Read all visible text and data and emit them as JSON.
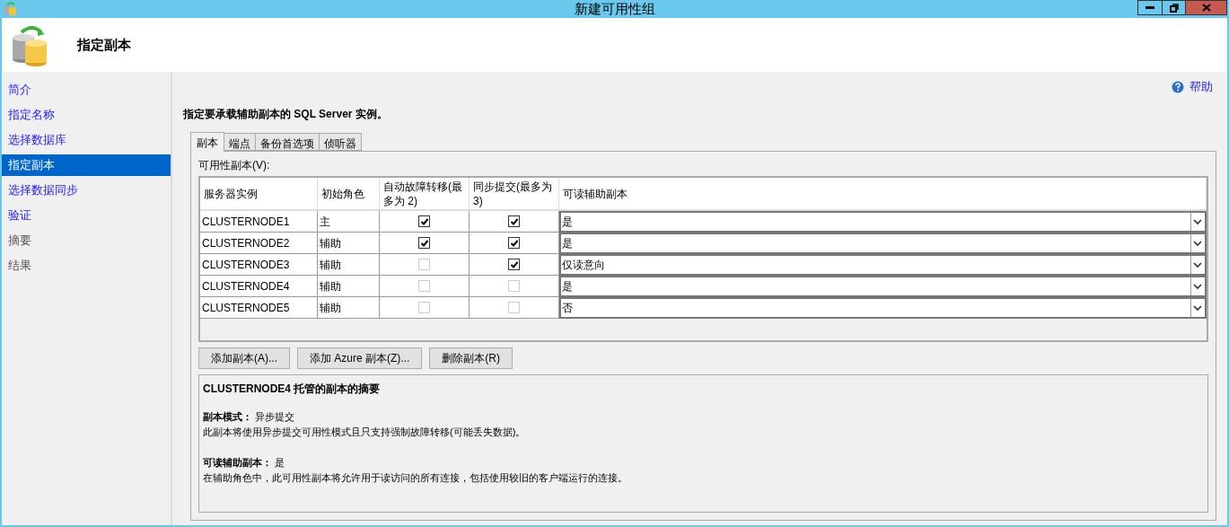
{
  "window": {
    "title": "新建可用性组"
  },
  "header": {
    "title": "指定副本"
  },
  "help": {
    "label": "帮助"
  },
  "sidebar": {
    "items": [
      {
        "label": "简介",
        "selected": false,
        "disabled": false
      },
      {
        "label": "指定名称",
        "selected": false,
        "disabled": false
      },
      {
        "label": "选择数据库",
        "selected": false,
        "disabled": false
      },
      {
        "label": "指定副本",
        "selected": true,
        "disabled": false
      },
      {
        "label": "选择数据同步",
        "selected": false,
        "disabled": false
      },
      {
        "label": "验证",
        "selected": false,
        "disabled": false
      },
      {
        "label": "摘要",
        "selected": false,
        "disabled": true
      },
      {
        "label": "结果",
        "selected": false,
        "disabled": true
      }
    ]
  },
  "instruction": "指定要承载辅助副本的 SQL Server 实例。",
  "tabs": [
    {
      "label": "副本",
      "selected": true
    },
    {
      "label": "端点",
      "selected": false
    },
    {
      "label": "备份首选项",
      "selected": false
    },
    {
      "label": "侦听器",
      "selected": false
    }
  ],
  "grid": {
    "label": "可用性副本(V):",
    "columns": [
      "服务器实例",
      "初始角色",
      "自动故障转移(最多为 2)",
      "同步提交(最多为 3)",
      "可读辅助副本"
    ],
    "rows": [
      {
        "instance": "CLUSTERNODE1",
        "role": "主",
        "auto_failover": {
          "checked": true
        },
        "sync_commit": {
          "checked": true
        },
        "readable": "是"
      },
      {
        "instance": "CLUSTERNODE2",
        "role": "辅助",
        "auto_failover": {
          "checked": true
        },
        "sync_commit": {
          "checked": true
        },
        "readable": "是"
      },
      {
        "instance": "CLUSTERNODE3",
        "role": "辅助",
        "auto_failover": {
          "checked": false
        },
        "sync_commit": {
          "checked": true
        },
        "readable": "仅读意向"
      },
      {
        "instance": "CLUSTERNODE4",
        "role": "辅助",
        "auto_failover": {
          "checked": false
        },
        "sync_commit": {
          "checked": false
        },
        "readable": "是"
      },
      {
        "instance": "CLUSTERNODE5",
        "role": "辅助",
        "auto_failover": {
          "checked": false
        },
        "sync_commit": {
          "checked": false
        },
        "readable": "否"
      }
    ]
  },
  "buttons": [
    "添加副本(A)...",
    "添加 Azure 副本(Z)...",
    "删除副本(R)"
  ],
  "summary": {
    "title": "CLUSTERNODE4 托管的副本的摘要",
    "sections": [
      {
        "heading": "**副本模式：** 异步提交",
        "description": "此副本将使用异步提交可用性模式且只支持强制故障转移(可能丢失数据)。"
      },
      {
        "heading": "**可读辅助副本：** 是",
        "description": "在辅助角色中，此可用性副本将允许用于读访问的所有连接，包括使用较旧的客户端运行的连接。"
      }
    ]
  }
}
